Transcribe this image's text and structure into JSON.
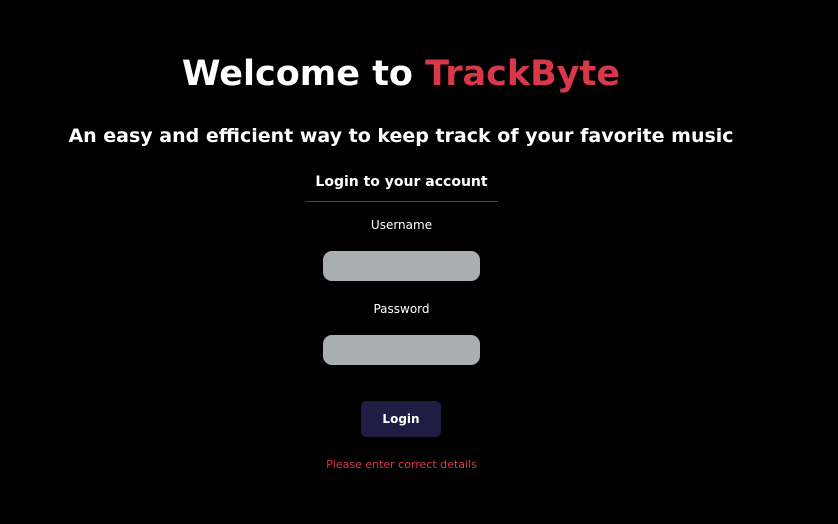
{
  "header": {
    "welcome_prefix": "Welcome to ",
    "brand_name": "TrackByte",
    "tagline": "An easy and efficient way to keep track of your favorite music"
  },
  "login": {
    "title": "Login to your account",
    "username_label": "Username",
    "username_value": "",
    "password_label": "Password",
    "password_value": "",
    "button_label": "Login",
    "error_message": "Please enter correct details"
  },
  "colors": {
    "background": "#000000",
    "brand_accent": "#d9384a",
    "input_background": "#a9aeb1",
    "button_background": "#1f1d43",
    "error_text": "#d9384a"
  }
}
